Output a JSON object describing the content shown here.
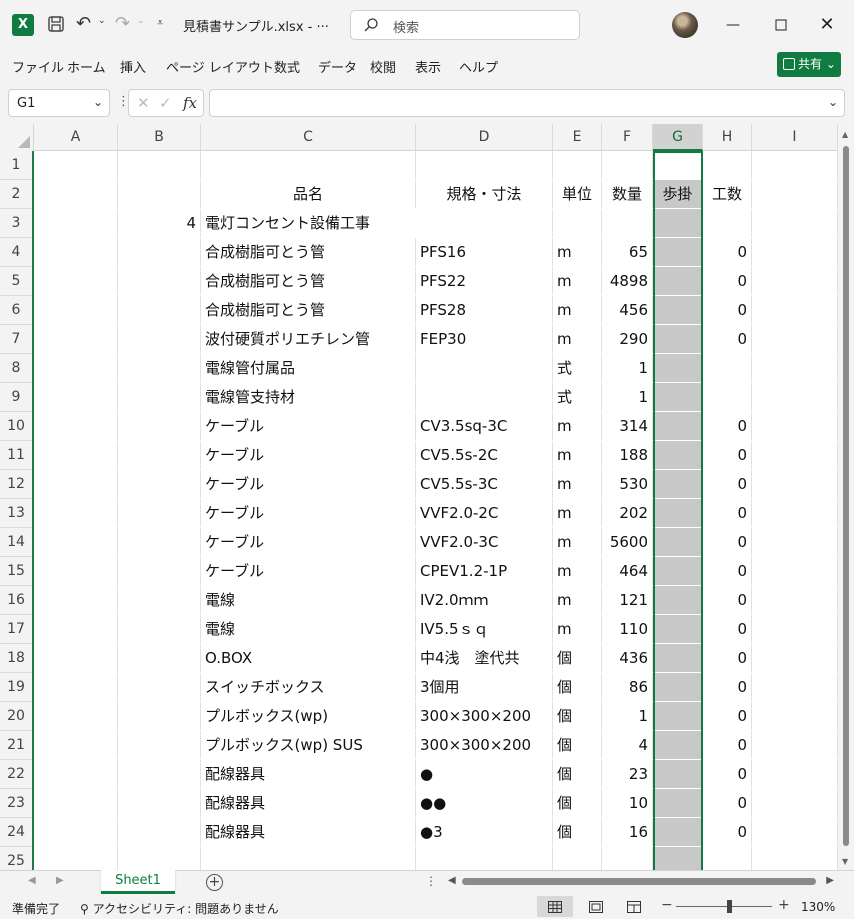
{
  "titlebar": {
    "logo": "X",
    "doc_title": "見積書サンプル.xlsx  -  ···",
    "search_placeholder": "検索",
    "minimize": "—",
    "close": "✕"
  },
  "menu": [
    "ファイル",
    "ホーム",
    "挿入",
    "ページ レイアウト",
    "数式",
    "データ",
    "校閲",
    "表示",
    "ヘルプ"
  ],
  "share_label": "共有",
  "formula_bar": {
    "name_box": "G1",
    "value": ""
  },
  "columns": [
    "A",
    "B",
    "C",
    "D",
    "E",
    "F",
    "G",
    "H",
    "I"
  ],
  "selected_column": "G",
  "rows": [
    {
      "n": "1",
      "b": "",
      "c": "",
      "d": "",
      "e": "",
      "f": "",
      "g": "",
      "h": ""
    },
    {
      "n": "2",
      "b": "",
      "c": "品名",
      "d": "規格・寸法",
      "e": "単位",
      "f": "数量",
      "g": "歩掛",
      "h": "工数"
    },
    {
      "n": "3",
      "b": "4",
      "c": "電灯コンセント設備工事",
      "d": "",
      "e": "",
      "f": "",
      "g": "",
      "h": ""
    },
    {
      "n": "4",
      "b": "",
      "c": "合成樹脂可とう管",
      "d": "PFS16",
      "e": "m",
      "f": "65",
      "g": "",
      "h": "0"
    },
    {
      "n": "5",
      "b": "",
      "c": "合成樹脂可とう管",
      "d": "PFS22",
      "e": "m",
      "f": "4898",
      "g": "",
      "h": "0"
    },
    {
      "n": "6",
      "b": "",
      "c": "合成樹脂可とう管",
      "d": "PFS28",
      "e": "m",
      "f": "456",
      "g": "",
      "h": "0"
    },
    {
      "n": "7",
      "b": "",
      "c": "波付硬質ポリエチレン管",
      "d": "FEP30",
      "e": "m",
      "f": "290",
      "g": "",
      "h": "0"
    },
    {
      "n": "8",
      "b": "",
      "c": "電線管付属品",
      "d": "",
      "e": "式",
      "f": "1",
      "g": "",
      "h": ""
    },
    {
      "n": "9",
      "b": "",
      "c": "電線管支持材",
      "d": "",
      "e": "式",
      "f": "1",
      "g": "",
      "h": ""
    },
    {
      "n": "10",
      "b": "",
      "c": "ケーブル",
      "d": "CV3.5sq-3C",
      "e": "m",
      "f": "314",
      "g": "",
      "h": "0"
    },
    {
      "n": "11",
      "b": "",
      "c": "ケーブル",
      "d": "CV5.5s-2C",
      "e": "m",
      "f": "188",
      "g": "",
      "h": "0"
    },
    {
      "n": "12",
      "b": "",
      "c": "ケーブル",
      "d": "CV5.5s-3C",
      "e": "m",
      "f": "530",
      "g": "",
      "h": "0"
    },
    {
      "n": "13",
      "b": "",
      "c": "ケーブル",
      "d": "VVF2.0-2C",
      "e": "m",
      "f": "202",
      "g": "",
      "h": "0"
    },
    {
      "n": "14",
      "b": "",
      "c": "ケーブル",
      "d": "VVF2.0-3C",
      "e": "m",
      "f": "5600",
      "g": "",
      "h": "0"
    },
    {
      "n": "15",
      "b": "",
      "c": "ケーブル",
      "d": "CPEV1.2-1P",
      "e": "m",
      "f": "464",
      "g": "",
      "h": "0"
    },
    {
      "n": "16",
      "b": "",
      "c": "電線",
      "d": "IV2.0ｍｍ",
      "e": "m",
      "f": "121",
      "g": "",
      "h": "0"
    },
    {
      "n": "17",
      "b": "",
      "c": "電線",
      "d": "IV5.5ｓｑ",
      "e": "m",
      "f": "110",
      "g": "",
      "h": "0"
    },
    {
      "n": "18",
      "b": "",
      "c": "O.BOX",
      "d": "中4浅　塗代共",
      "e": "個",
      "f": "436",
      "g": "",
      "h": "0"
    },
    {
      "n": "19",
      "b": "",
      "c": "スイッチボックス",
      "d": "3個用",
      "e": "個",
      "f": "86",
      "g": "",
      "h": "0"
    },
    {
      "n": "20",
      "b": "",
      "c": "プルボックス(wp)",
      "d": "300×300×200",
      "e": "個",
      "f": "1",
      "g": "",
      "h": "0"
    },
    {
      "n": "21",
      "b": "",
      "c": "プルボックス(wp) SUS",
      "d": "300×300×200",
      "e": "個",
      "f": "4",
      "g": "",
      "h": "0"
    },
    {
      "n": "22",
      "b": "",
      "c": "配線器具",
      "d": "●",
      "e": "個",
      "f": "23",
      "g": "",
      "h": "0"
    },
    {
      "n": "23",
      "b": "",
      "c": "配線器具",
      "d": "●●",
      "e": "個",
      "f": "10",
      "g": "",
      "h": "0"
    },
    {
      "n": "24",
      "b": "",
      "c": "配線器具",
      "d": "●3",
      "e": "個",
      "f": "16",
      "g": "",
      "h": "0"
    },
    {
      "n": "25",
      "b": "",
      "c": "",
      "d": "",
      "e": "",
      "f": "",
      "g": "",
      "h": ""
    }
  ],
  "sheet_tab": "Sheet1",
  "status": {
    "ready": "準備完了",
    "accessibility": "アクセシビリティ: 問題ありません",
    "zoom": "130%"
  },
  "colors": {
    "accent": "#107c41",
    "selected_column_fill": "#c8c8c8"
  }
}
